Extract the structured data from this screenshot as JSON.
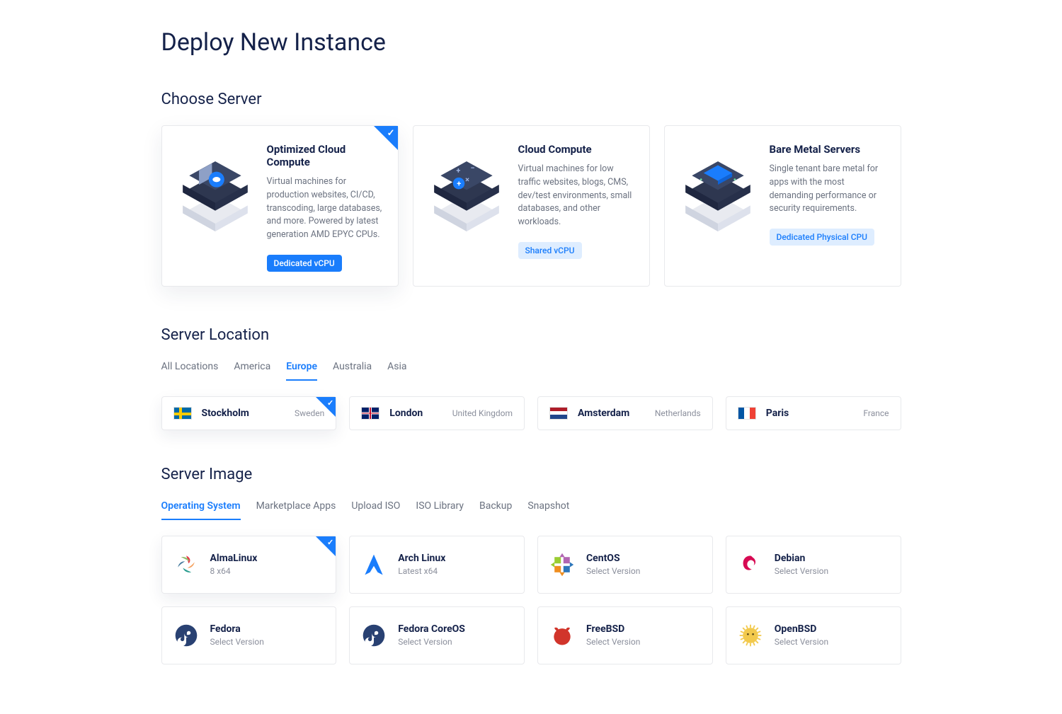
{
  "page_title": "Deploy New Instance",
  "sections": {
    "choose_server": "Choose Server",
    "server_location": "Server Location",
    "server_image": "Server Image"
  },
  "server_types": [
    {
      "title": "Optimized Cloud Compute",
      "desc": "Virtual machines for production websites, CI/CD, transcoding, large databases, and more. Powered by latest generation AMD EPYC CPUs.",
      "badge": "Dedicated vCPU",
      "badge_style": "solid",
      "selected": true
    },
    {
      "title": "Cloud Compute",
      "desc": "Virtual machines for low traffic websites, blogs, CMS, dev/test environments, small databases, and other workloads.",
      "badge": "Shared vCPU",
      "badge_style": "light",
      "selected": false
    },
    {
      "title": "Bare Metal Servers",
      "desc": "Single tenant bare metal for apps with the most demanding performance or security requirements.",
      "badge": "Dedicated Physical CPU",
      "badge_style": "light",
      "selected": false
    }
  ],
  "location_tabs": [
    "All Locations",
    "America",
    "Europe",
    "Australia",
    "Asia"
  ],
  "location_tab_active": "Europe",
  "locations": [
    {
      "city": "Stockholm",
      "country": "Sweden",
      "flag": "se",
      "selected": true
    },
    {
      "city": "London",
      "country": "United Kingdom",
      "flag": "gb",
      "selected": false
    },
    {
      "city": "Amsterdam",
      "country": "Netherlands",
      "flag": "nl",
      "selected": false
    },
    {
      "city": "Paris",
      "country": "France",
      "flag": "fr",
      "selected": false
    }
  ],
  "image_tabs": [
    "Operating System",
    "Marketplace Apps",
    "Upload ISO",
    "ISO Library",
    "Backup",
    "Snapshot"
  ],
  "image_tab_active": "Operating System",
  "os_list": [
    {
      "name": "AlmaLinux",
      "sub": "8  x64",
      "selected": true,
      "icon": "almalinux"
    },
    {
      "name": "Arch Linux",
      "sub": "Latest  x64",
      "selected": false,
      "icon": "arch"
    },
    {
      "name": "CentOS",
      "sub": "Select Version",
      "selected": false,
      "icon": "centos"
    },
    {
      "name": "Debian",
      "sub": "Select Version",
      "selected": false,
      "icon": "debian"
    },
    {
      "name": "Fedora",
      "sub": "Select Version",
      "selected": false,
      "icon": "fedora"
    },
    {
      "name": "Fedora CoreOS",
      "sub": "Select Version",
      "selected": false,
      "icon": "fedora"
    },
    {
      "name": "FreeBSD",
      "sub": "Select Version",
      "selected": false,
      "icon": "freebsd"
    },
    {
      "name": "OpenBSD",
      "sub": "Select Version",
      "selected": false,
      "icon": "openbsd"
    }
  ]
}
